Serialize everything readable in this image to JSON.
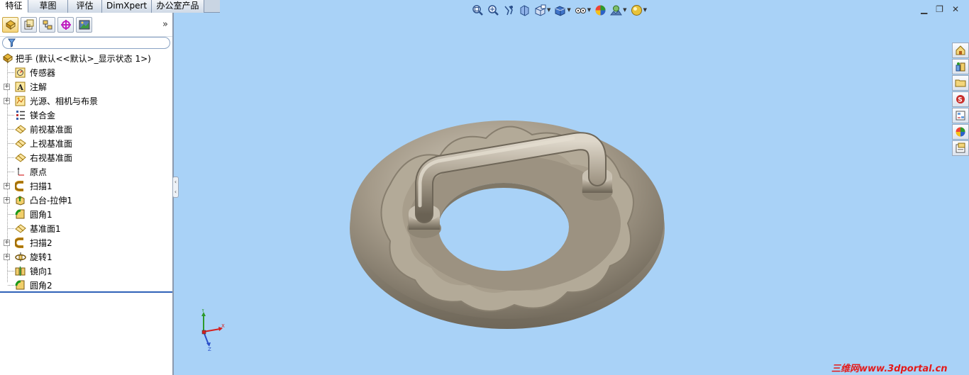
{
  "tabs": [
    "特征",
    "草图",
    "评估",
    "DimXpert",
    "办公室产品"
  ],
  "active_tab": 0,
  "manager_tabs": [
    "feature-manager-icon",
    "property-manager-icon",
    "configuration-manager-icon",
    "dimxpert-manager-icon",
    "display-manager-icon"
  ],
  "tree": {
    "root_label": "把手 (默认<<默认>_显示状态 1>)",
    "items": [
      {
        "label": "传感器",
        "icon": "sensor-icon",
        "expandable": false
      },
      {
        "label": "注解",
        "icon": "annotation-icon",
        "expandable": true
      },
      {
        "label": "光源、相机与布景",
        "icon": "lights-cameras-icon",
        "expandable": true
      },
      {
        "label": "镁合金",
        "icon": "material-icon",
        "expandable": false
      },
      {
        "label": "前视基准面",
        "icon": "plane-icon",
        "expandable": false
      },
      {
        "label": "上视基准面",
        "icon": "plane-icon",
        "expandable": false
      },
      {
        "label": "右视基准面",
        "icon": "plane-icon",
        "expandable": false
      },
      {
        "label": "原点",
        "icon": "origin-icon",
        "expandable": false
      },
      {
        "label": "扫描1",
        "icon": "sweep-icon",
        "expandable": true
      },
      {
        "label": "凸台-拉伸1",
        "icon": "extrude-icon",
        "expandable": true
      },
      {
        "label": "圆角1",
        "icon": "fillet-icon",
        "expandable": false
      },
      {
        "label": "基准面1",
        "icon": "plane-icon",
        "expandable": false
      },
      {
        "label": "扫描2",
        "icon": "sweep-icon",
        "expandable": true
      },
      {
        "label": "旋转1",
        "icon": "revolve-icon",
        "expandable": true
      },
      {
        "label": "镜向1",
        "icon": "mirror-icon",
        "expandable": false
      },
      {
        "label": "圆角2",
        "icon": "fillet-icon",
        "expandable": false
      }
    ]
  },
  "heads_up_toolbar": [
    "zoom-to-fit-icon",
    "zoom-to-area-icon",
    "previous-view-icon",
    "section-view-icon",
    "view-orientation-icon",
    "display-style-icon",
    "hide-show-items-icon",
    "edit-appearance-icon",
    "apply-scene-icon",
    "view-settings-icon"
  ],
  "task_pane": [
    "solidworks-resources-icon",
    "design-library-icon",
    "file-explorer-icon",
    "search-icon",
    "view-palette-icon",
    "appearances-icon",
    "custom-properties-icon"
  ],
  "triad": {
    "x": "X",
    "y": "Y",
    "z": "Z"
  },
  "watermark": "三维网www.3dportal.cn",
  "colors": {
    "viewport_bg": "#a9d2f7",
    "model": "#a49a89",
    "selection": "#2f62b8",
    "watermark": "#e41a1a"
  }
}
